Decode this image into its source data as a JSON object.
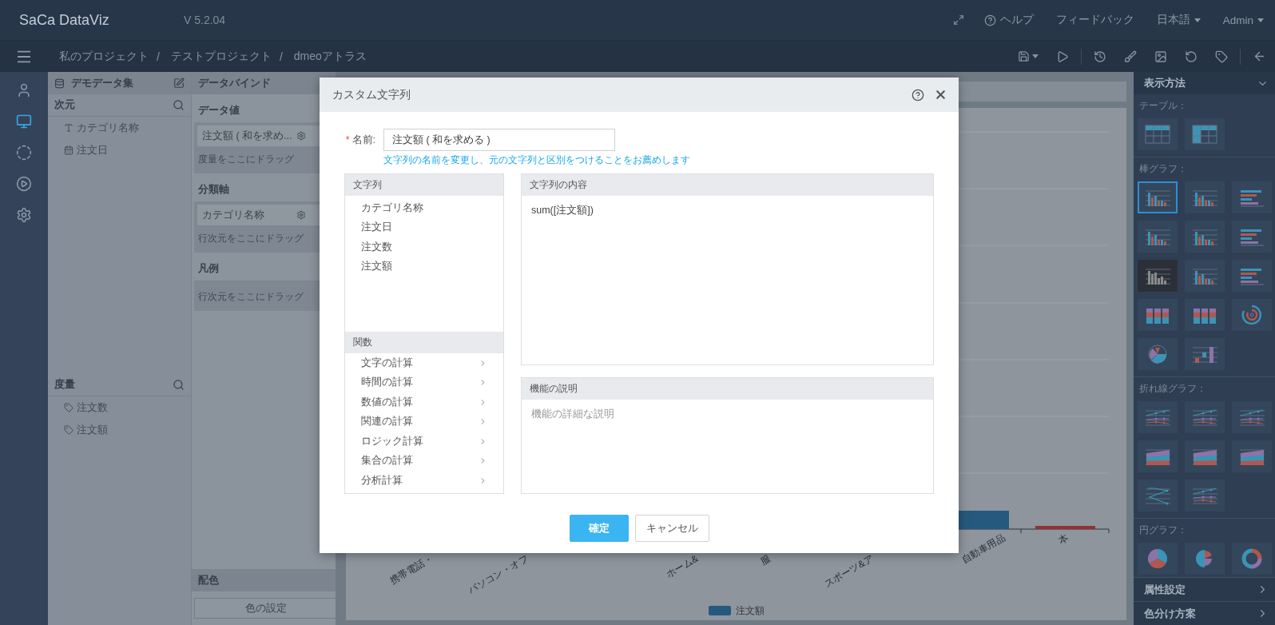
{
  "app": {
    "logo": "SaCa DataViz",
    "version": "V 5.2.04"
  },
  "header": {
    "help": "ヘルプ",
    "feedback": "フィードバック",
    "language": "日本語",
    "user": "Admin"
  },
  "breadcrumb": {
    "separator": "/",
    "items": [
      "私のプロジェクト",
      "テストプロジェクト",
      "dmeoアトラス"
    ]
  },
  "rail": [
    {
      "kind": "user",
      "selected": false
    },
    {
      "kind": "monitor",
      "selected": true
    },
    {
      "kind": "cycle",
      "selected": false
    },
    {
      "kind": "play",
      "selected": false
    },
    {
      "kind": "settings",
      "selected": false
    }
  ],
  "dataset": {
    "title": "デモデータ集",
    "dimensions": {
      "title": "次元",
      "items": [
        {
          "kind": "text",
          "label": "カテゴリ名称"
        },
        {
          "kind": "date",
          "label": "注文日"
        }
      ]
    },
    "measures": {
      "title": "度量",
      "items": [
        {
          "kind": "measure",
          "label": "注文数"
        },
        {
          "kind": "measure",
          "label": "注文額"
        }
      ]
    }
  },
  "binding": {
    "title": "データバインド",
    "sections": [
      {
        "title": "データ値",
        "chips": [
          "注文額 ( 和を求め..."
        ],
        "hint": "度量をここにドラッグ"
      },
      {
        "title": "分類軸",
        "chips": [
          "カテゴリ名称"
        ],
        "hint": "行次元をここにドラッグ"
      },
      {
        "title": "凡例",
        "hint": "行次元をここにドラッグ"
      }
    ],
    "color": {
      "title": "配色",
      "button": "色の設定"
    }
  },
  "chart": {
    "category_labels": [
      "携帯電話・",
      "パソコン・オフ",
      "ホーム&",
      "服",
      "スポーツ&ア",
      "自動車用品",
      "本"
    ],
    "legend": "注文額"
  },
  "display": {
    "title": "表示方法",
    "groups": [
      {
        "title": "テーブル：",
        "items": [
          {
            "kind": "table",
            "selected": false
          },
          {
            "kind": "table-merged",
            "selected": false
          }
        ]
      },
      {
        "title": "棒グラフ：",
        "items": [
          {
            "kind": "bar",
            "selected": true
          },
          {
            "kind": "bar",
            "selected": false
          },
          {
            "kind": "hbar",
            "selected": false
          },
          {
            "kind": "bar",
            "selected": false
          },
          {
            "kind": "bar",
            "selected": false
          },
          {
            "kind": "hbar",
            "selected": false
          },
          {
            "kind": "bar-mono",
            "selected": false
          },
          {
            "kind": "bar",
            "selected": false
          },
          {
            "kind": "hbar",
            "selected": false
          },
          {
            "kind": "bar3d",
            "selected": false
          },
          {
            "kind": "bar3d",
            "selected": false
          },
          {
            "kind": "radial",
            "selected": false
          },
          {
            "kind": "polar",
            "selected": false
          },
          {
            "kind": "waterfall",
            "selected": false
          }
        ]
      },
      {
        "title": "折れ線グラフ：",
        "items": [
          {
            "kind": "line",
            "selected": false
          },
          {
            "kind": "line",
            "selected": false
          },
          {
            "kind": "line",
            "selected": false
          },
          {
            "kind": "area",
            "selected": false
          },
          {
            "kind": "area",
            "selected": false
          },
          {
            "kind": "area",
            "selected": false
          },
          {
            "kind": "line-cross",
            "selected": false
          },
          {
            "kind": "line",
            "selected": false
          }
        ]
      },
      {
        "title": "円グラフ：",
        "items": [
          {
            "kind": "pie",
            "selected": false
          },
          {
            "kind": "pie-rose",
            "selected": false
          },
          {
            "kind": "donut",
            "selected": false
          }
        ]
      }
    ],
    "footer": [
      "属性設定",
      "色分け方案"
    ]
  },
  "dialog": {
    "title": "カスタム文字列",
    "required_mark": "*",
    "name_label": "名前:",
    "name_value": "注文額 ( 和を求める )",
    "hint": "文字列の名前を変更し、元の文字列と区別をつけることをお薦めします",
    "fields": {
      "title": "文字列",
      "items": [
        "カテゴリ名称",
        "注文日",
        "注文数",
        "注文額"
      ]
    },
    "functions": {
      "title": "関数",
      "items": [
        "文字の計算",
        "時間の計算",
        "数値の計算",
        "関連の計算",
        "ロジック計算",
        "集合の計算",
        "分析計算"
      ]
    },
    "content": {
      "title": "文字列の内容",
      "value": "sum([注文額])"
    },
    "description": {
      "title": "機能の説明",
      "placeholder": "機能の詳細な説明"
    },
    "buttons": [
      {
        "kind": "primary",
        "label": "確定"
      },
      {
        "kind": "default",
        "label": "キャンセル"
      }
    ]
  }
}
